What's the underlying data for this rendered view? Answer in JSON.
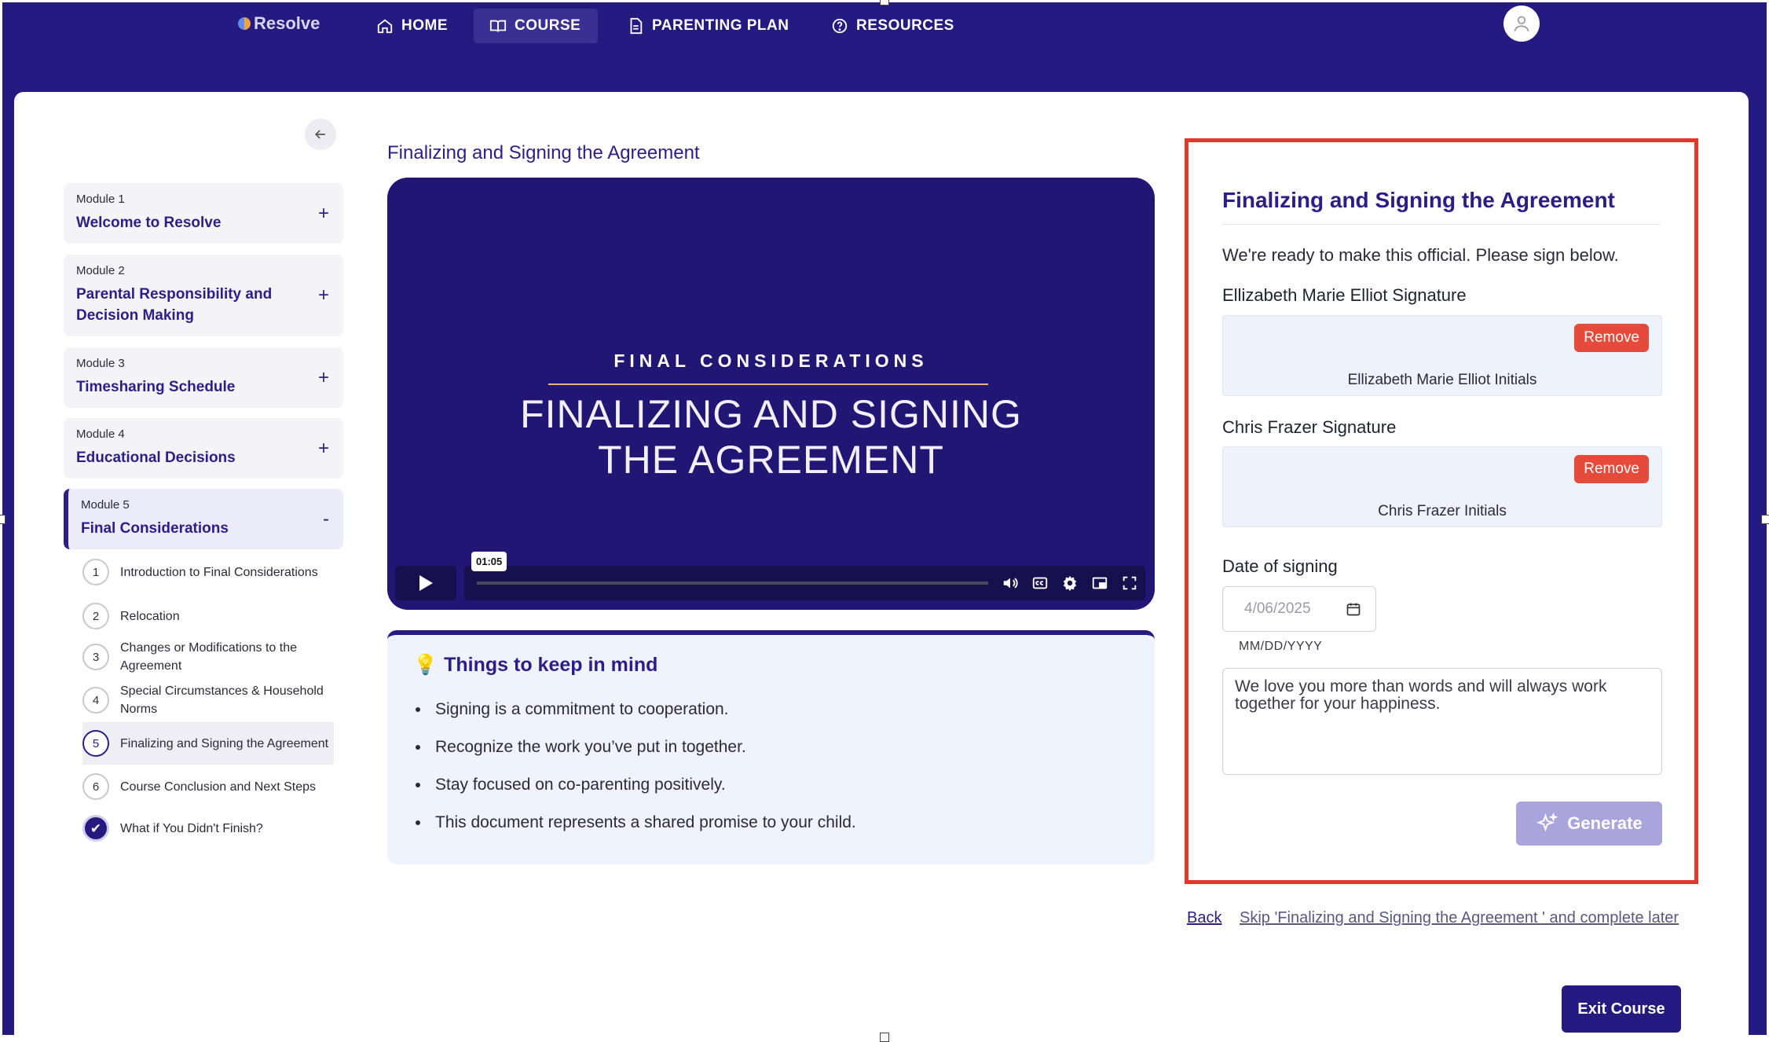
{
  "nav": {
    "logo": "Resolve",
    "items": [
      {
        "label": "HOME",
        "icon": "home-icon"
      },
      {
        "label": "COURSE",
        "icon": "book-icon"
      },
      {
        "label": "PARENTING PLAN",
        "icon": "document-icon"
      },
      {
        "label": "RESOURCES",
        "icon": "help-circle-icon"
      }
    ],
    "active": "COURSE"
  },
  "sidebar": {
    "modules": [
      {
        "number": "Module 1",
        "title": "Welcome to Resolve",
        "toggle": "+"
      },
      {
        "number": "Module 2",
        "title": "Parental Responsibility and Decision Making",
        "toggle": "+"
      },
      {
        "number": "Module 3",
        "title": "Timesharing Schedule",
        "toggle": "+"
      },
      {
        "number": "Module 4",
        "title": "Educational Decisions",
        "toggle": "+"
      },
      {
        "number": "Module 5",
        "title": "Final Considerations",
        "toggle": "-"
      }
    ],
    "lessons": [
      {
        "num": "1",
        "title": "Introduction to Final Considerations"
      },
      {
        "num": "2",
        "title": "Relocation"
      },
      {
        "num": "3",
        "title": "Changes or Modifications to the Agreement"
      },
      {
        "num": "4",
        "title": "Special Circumstances & Household Norms"
      },
      {
        "num": "5",
        "title": "Finalizing and Signing the Agreement"
      },
      {
        "num": "6",
        "title": "Course Conclusion and Next Steps"
      },
      {
        "num": "✔",
        "title": "What if You Didn't Finish?"
      }
    ],
    "current_lesson": "5"
  },
  "video": {
    "heading": "Finalizing and Signing the Agreement",
    "kicker": "FINAL CONSIDERATIONS",
    "title_line1": "FINALIZING AND SIGNING",
    "title_line2": "THE AGREEMENT",
    "time": "01:05"
  },
  "tips": {
    "title": "Things to keep in mind",
    "items": [
      "Signing is a commitment to cooperation.",
      "Recognize the work you’ve put in together.",
      "Stay focused on co-parenting positively.",
      "This document represents a shared promise to your child."
    ]
  },
  "form": {
    "title": "Finalizing and Signing the Agreement",
    "intro": "We're ready to make this official. Please sign below.",
    "signatures": [
      {
        "label": "Ellizabeth Marie Elliot Signature",
        "initials": "Ellizabeth Marie Elliot Initials",
        "remove": "Remove"
      },
      {
        "label": "Chris Frazer Signature",
        "initials": "Chris Frazer Initials",
        "remove": "Remove"
      }
    ],
    "date_label": "Date of signing",
    "date_value": "4/06/2025",
    "date_hint": "MM/DD/YYYY",
    "message": "We love you more than words and will always work together for your happiness.",
    "generate": "Generate"
  },
  "footer": {
    "back": "Back",
    "skip": "Skip 'Finalizing and Signing the Agreement ' and complete later",
    "exit": "Exit Course"
  },
  "colors": {
    "brand": "#251a80",
    "accent_text": "#2b1f87",
    "remove": "#e64a3b",
    "highlight_border": "#e0392b",
    "generate_disabled": "#a9a4dc"
  }
}
